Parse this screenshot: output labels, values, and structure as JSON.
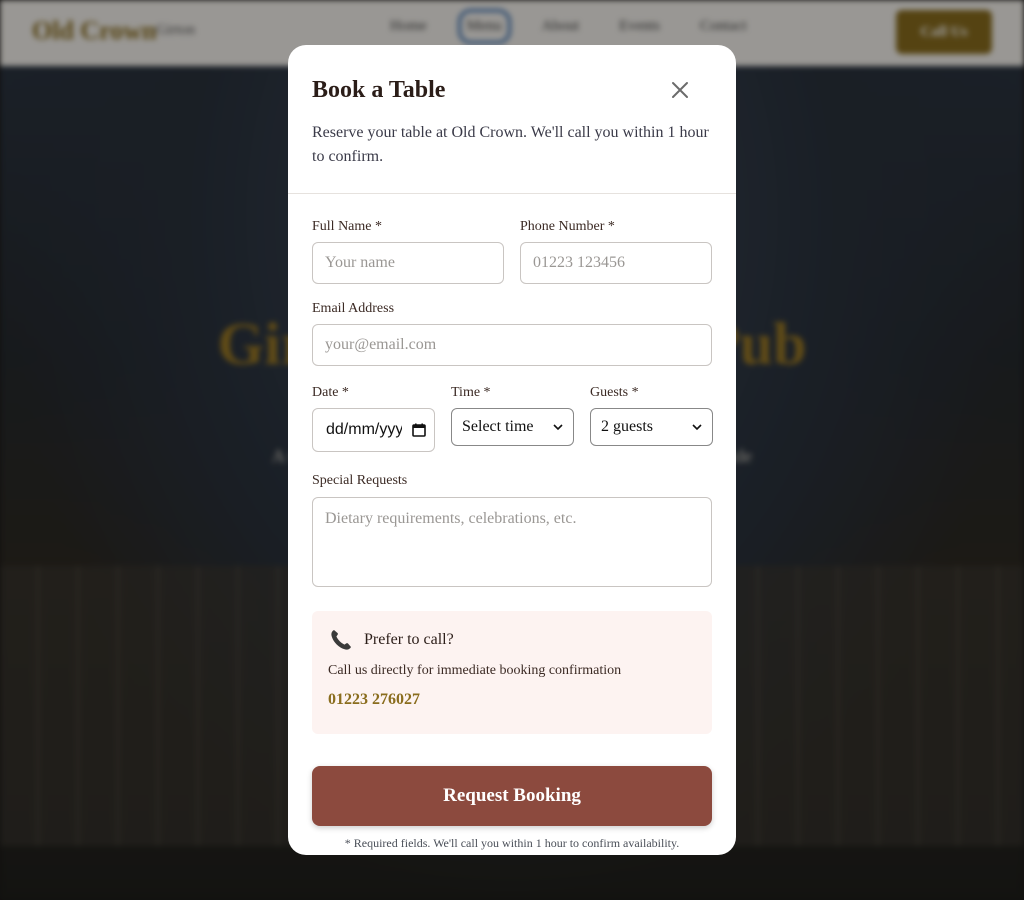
{
  "background": {
    "logo": "Old Crown",
    "logo_sub": "Girton",
    "nav_links": [
      "Home",
      "Menu",
      "About",
      "Events",
      "Contact"
    ],
    "call_button": "Call Us",
    "hero_title": "Girton's Thatched Pub",
    "hero_subtitle": "A welcoming village pub with seasonal dishes and a warm fireside",
    "hero_tagline": "Authentic English Pub Dining Near Girton College"
  },
  "modal": {
    "title": "Book a Table",
    "description": "Reserve your table at Old Crown. We'll call you within 1 hour to confirm.",
    "fields": {
      "name_label": "Full Name *",
      "name_placeholder": "Your name",
      "phone_label": "Phone Number *",
      "phone_placeholder": "01223 123456",
      "email_label": "Email Address",
      "email_placeholder": "your@email.com",
      "date_label": "Date *",
      "date_value": "dd/mm/yyyy",
      "time_label": "Time *",
      "time_value": "Select time",
      "guests_label": "Guests *",
      "guests_value": "2 guests",
      "requests_label": "Special Requests",
      "requests_placeholder": "Dietary requirements, celebrations, etc."
    },
    "call_box": {
      "title": "Prefer to call?",
      "text": "Call us directly for immediate booking confirmation",
      "number": "01223 276027"
    },
    "submit_label": "Request Booking",
    "footnote": "* Required fields. We'll call you within 1 hour to confirm availability."
  },
  "colors": {
    "accent": "#8c4a3e",
    "gold": "#8a6d1e",
    "call_box_bg": "#fdf3f1"
  }
}
